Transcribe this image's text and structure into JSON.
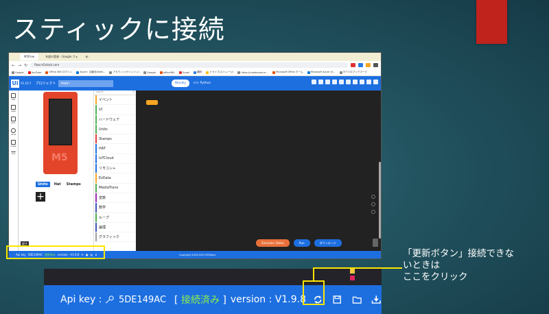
{
  "slide": {
    "title": "スティックに接続",
    "note_line1": "「更新ボタン」接続できな",
    "note_line2": "いときは",
    "note_line3": "ここをクリック",
    "accent_colors": {
      "highlight": "#ffe600",
      "red_block": "#c0221c",
      "uiflow_blue": "#1d6fe0"
    }
  },
  "browser": {
    "tabs": [
      {
        "label": "M5Flow",
        "active": true
      },
      {
        "label": "年度の登録 - Google フォ",
        "active": false
      }
    ],
    "new_tab": "+",
    "url": "flow.m5stack.com",
    "bookmarks": [
      "Google",
      "YouTube",
      "Office 365 ログイン",
      "Azure：自動化/Web...",
      "アカウント(サインイン)",
      "Google",
      "office365",
      "Gmail",
      "翻訳",
      "ドライブ(ストレージ)",
      "https://makecode.m...",
      "Microsoft Office ホーム",
      "Microsoft Azure ポ...",
      "すべてのブックマーク"
    ]
  },
  "uiflow": {
    "logo": "Ui",
    "version": "V1.10.7",
    "project_label": "プロジェクト",
    "project_name": "main",
    "mode_blockly": "Blockly",
    "mode_python": "</> Python",
    "left_tools": [
      "Title",
      "Label",
      "Rect",
      "Circle",
      "Image",
      "Line"
    ],
    "unit_tabs": {
      "units": "Units",
      "hat": "Hat",
      "stamps": "Stamps"
    },
    "add_button": "+",
    "bottom_label": "縦す",
    "search_placeholder": "search",
    "categories": [
      {
        "label": "イベント",
        "color": "#f5a623"
      },
      {
        "label": "UI",
        "color": "#4caf50"
      },
      {
        "label": "ハードウェア",
        "color": "#4caf50"
      },
      {
        "label": "Units",
        "color": "#4caf50"
      },
      {
        "label": "Stamps",
        "color": "#e53935"
      },
      {
        "label": "HAT",
        "color": "#1d6fe0"
      },
      {
        "label": "IoTCloud",
        "color": "#1d6fe0"
      },
      {
        "label": "リモコン+",
        "color": "#1d6fe0"
      },
      {
        "label": "EzData",
        "color": "#f5a623"
      },
      {
        "label": "MediaTrans",
        "color": "#4caf50"
      },
      {
        "label": "変数",
        "color": "#9c27b0"
      },
      {
        "label": "数学",
        "color": "#3f51b5"
      },
      {
        "label": "ループ",
        "color": "#4caf50"
      },
      {
        "label": "論理",
        "color": "#3f51b5"
      },
      {
        "label": "グラフィック",
        "color": "#9e9e9e"
      }
    ],
    "run_buttons": {
      "simulator": "Simulator (Beta)",
      "run": "Run",
      "download": "ダウンロード"
    },
    "status": {
      "api_key_label": "Api key",
      "api_key": "5DE149AC",
      "connected": "接続済み",
      "version": "version : V1.9.8",
      "copyright": "Copyright 2016-2023 M5Stack"
    }
  },
  "zoomed_bar": {
    "api_key_label": "Api key :",
    "api_key": "5DE149AC",
    "connected": "接続済み",
    "version": "version : V1.9.8"
  }
}
